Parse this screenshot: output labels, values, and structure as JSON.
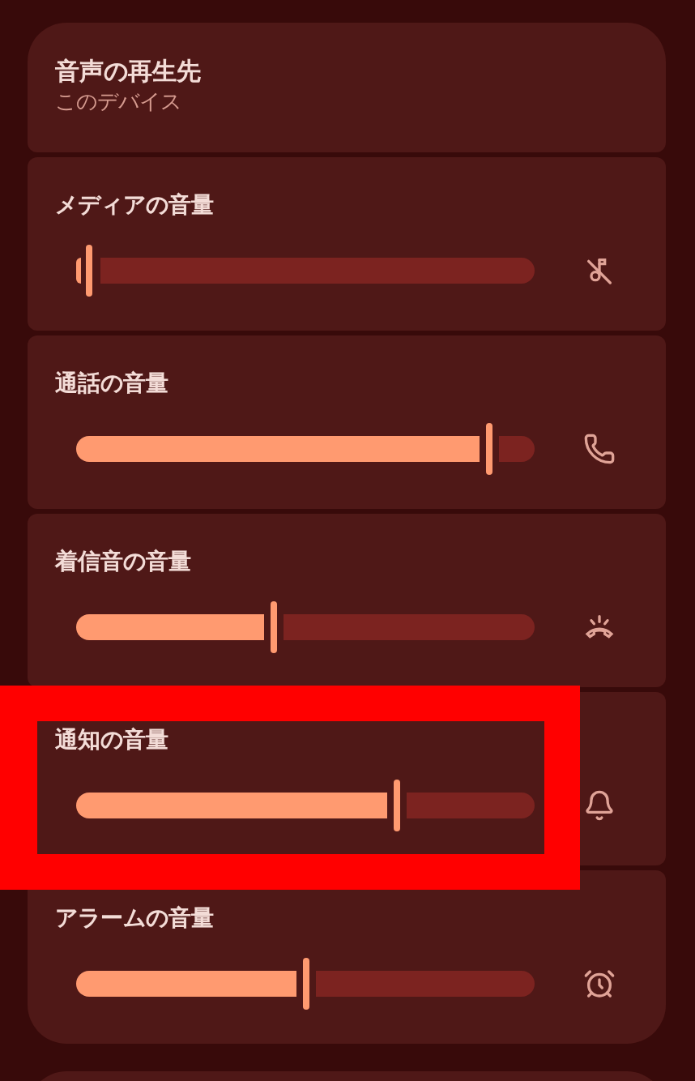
{
  "output": {
    "title": "音声の再生先",
    "value": "このデバイス"
  },
  "volumes": [
    {
      "label": "メディアの音量",
      "level": 0.03,
      "kind": "media-muted",
      "highlighted": false
    },
    {
      "label": "通話の音量",
      "level": 0.9,
      "kind": "call",
      "highlighted": false
    },
    {
      "label": "着信音の音量",
      "level": 0.43,
      "kind": "ring",
      "highlighted": false
    },
    {
      "label": "通知の音量",
      "level": 0.7,
      "kind": "notification",
      "highlighted": true
    },
    {
      "label": "アラームの音量",
      "level": 0.5,
      "kind": "alarm",
      "highlighted": false
    }
  ]
}
